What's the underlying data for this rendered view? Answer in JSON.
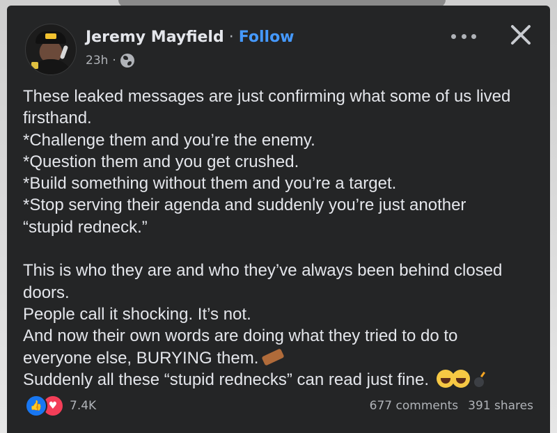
{
  "post": {
    "author": "Jeremy Mayfield",
    "separator": "·",
    "follow_label": "Follow",
    "timestamp": "23h",
    "meta_separator": "·",
    "audience_icon": "globe-icon",
    "body_lines": [
      "These leaked messages are just confirming what some of us lived",
      "firsthand.",
      "*Challenge them and you’re the enemy.",
      "*Question them and you get crushed.",
      "*Build something without them and you’re a target.",
      "*Stop serving their agenda and suddenly you’re just another",
      "“stupid redneck.”",
      "",
      "This is who they are and who they’ve always been behind closed",
      "doors.",
      "People call it shocking. It’s not.",
      "And now their own words are doing what they tried to do to",
      "everyone else, BURYING them.",
      "Suddenly all these “stupid rednecks” can read just fine."
    ],
    "emoji_after_line_12": "coffin-icon",
    "emoji_after_line_13": [
      "laugh-icon",
      "laugh-icon",
      "bomb-icon"
    ]
  },
  "footer": {
    "reaction_icons": [
      "like-icon",
      "love-icon"
    ],
    "reaction_count": "7.4K",
    "comments": "677 comments",
    "shares": "391 shares"
  },
  "colors": {
    "card_background": "#242526",
    "text": "#e4e6eb",
    "secondary_text": "#b0b3b8",
    "follow_blue": "#4599ff",
    "like_blue": "#1877f2",
    "love_red": "#f33e58"
  }
}
